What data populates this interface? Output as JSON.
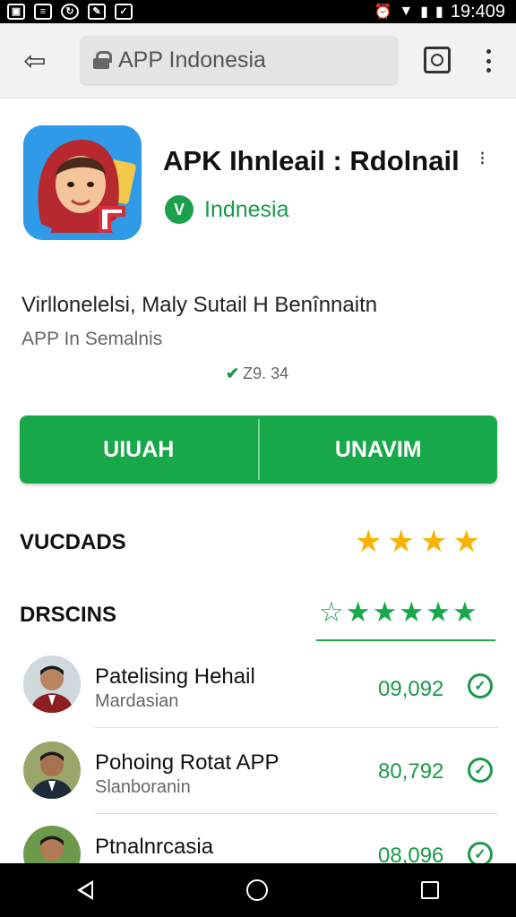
{
  "status_bar": {
    "time": "19:409",
    "left_icons": [
      "notification-icon",
      "document-icon",
      "sync-icon",
      "edit-icon",
      "mail-icon"
    ],
    "right_icons": [
      "alarm-icon",
      "wifi-icon",
      "signal-icon",
      "battery-icon"
    ]
  },
  "browser": {
    "url_text": "APP Indonesia"
  },
  "app": {
    "title": "APK Ihnleail : Rdolnail",
    "vendor_badge": "V",
    "vendor_name": "Indnesia",
    "description": "Virllonelelsi, Maly Sutail H Benînnaitn",
    "subtitle": "APP In Semalnis",
    "version_check": "✔",
    "version": "Z9. 34"
  },
  "buttons": {
    "left": "UIUAH",
    "right": "UNAVIM"
  },
  "sections": {
    "first": {
      "title": "VUCDADS",
      "star_count": 4
    },
    "second": {
      "title": "DRSCINS",
      "star_count": 6
    }
  },
  "list": [
    {
      "name": "Patelising Hehail",
      "sub": "Mardasian",
      "value": "09,092"
    },
    {
      "name": "Pohoing Rotat APP",
      "sub": "Slanboranin",
      "value": "80,792"
    },
    {
      "name": "Ptnalnrcasia",
      "sub": "",
      "value": "08,096"
    }
  ],
  "colors": {
    "accent_green": "#17a84a",
    "star_gold": "#f6b400",
    "app_icon_bg": "#2f9be8"
  }
}
